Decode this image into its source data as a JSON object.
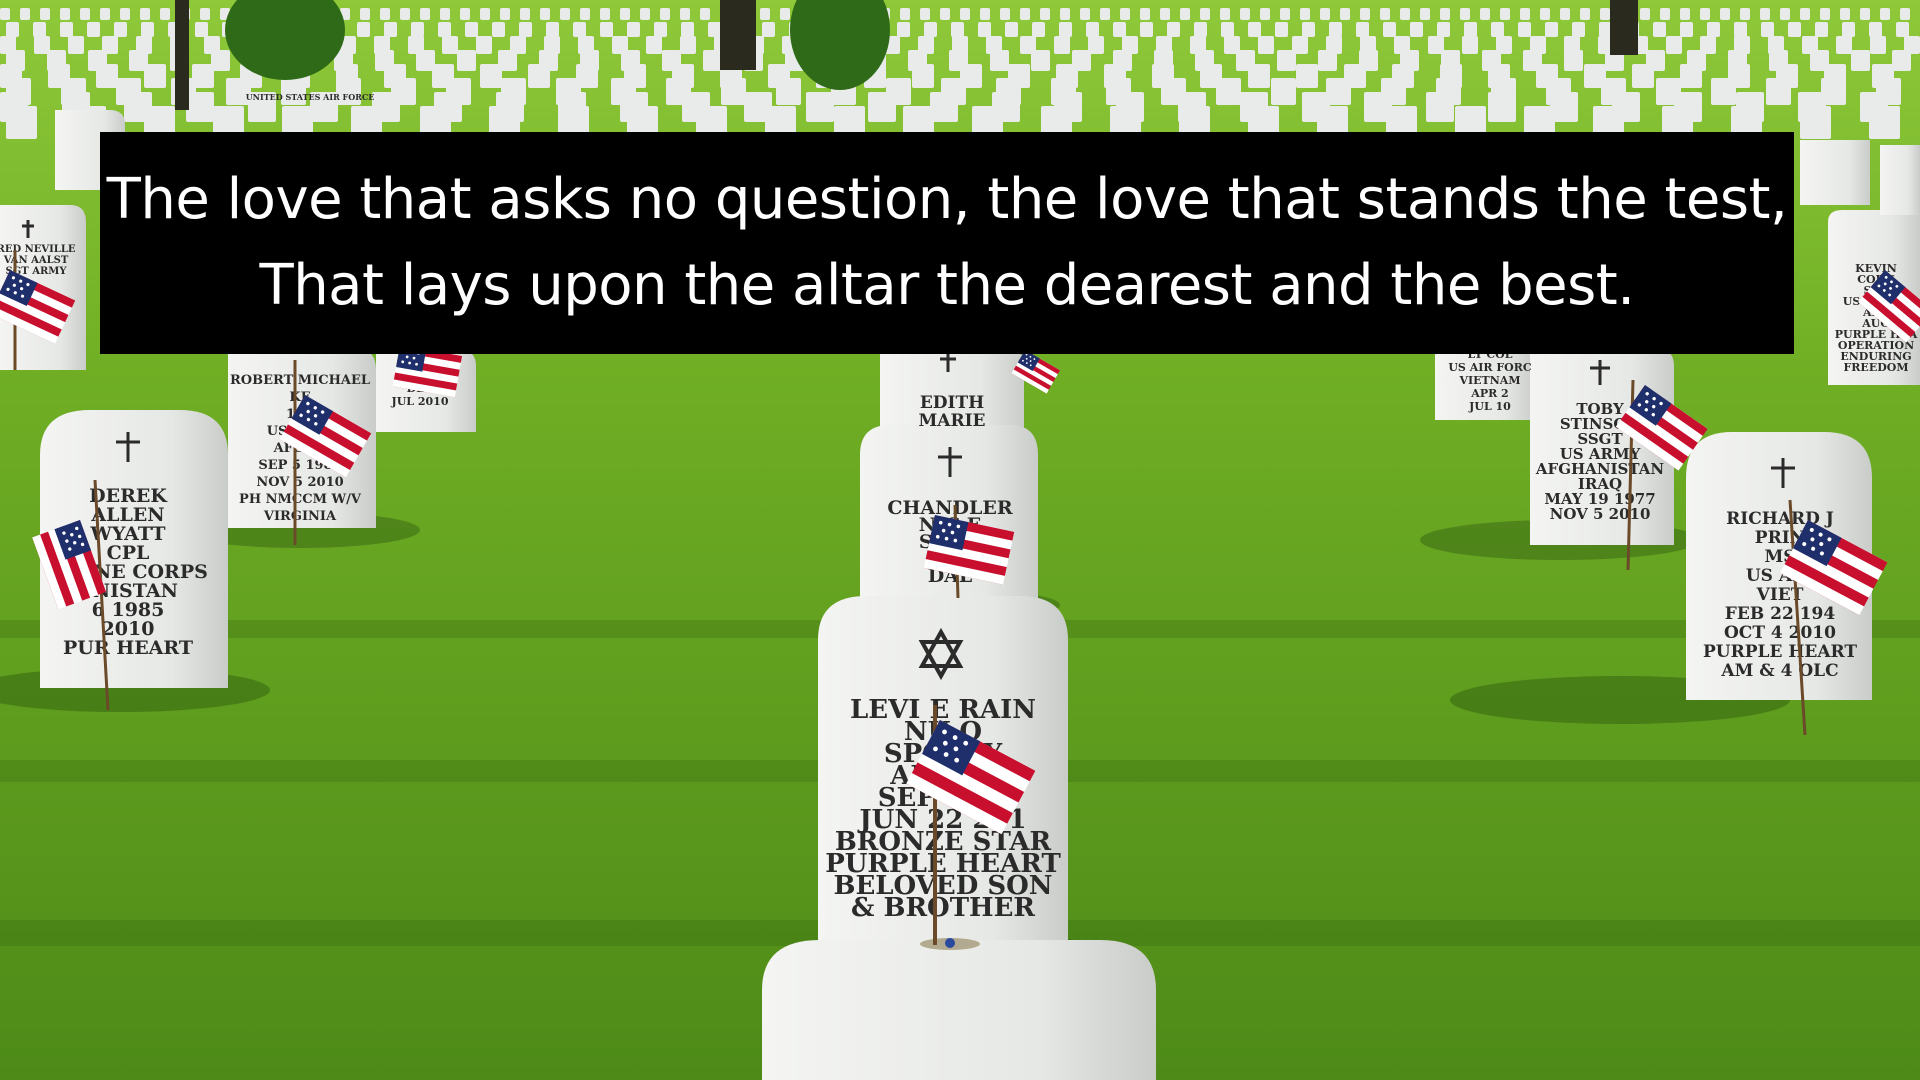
{
  "quote": {
    "line1": "The love that asks no question, the love that stands the test,",
    "line2": "That lays upon the altar the dearest and the best."
  },
  "headstones": {
    "center_front": {
      "symbol": "star-of-david-icon",
      "lines": [
        "LEVI E RAIN",
        "NU  O",
        "SPC U    Y",
        "AFGHA",
        "SEP  1  19",
        "JUN 22 201",
        "BRONZE STAR",
        "PURPLE HEART",
        "BELOVED SON",
        "& BROTHER"
      ]
    },
    "left_front": {
      "symbol": "cross-icon",
      "lines": [
        "DEREK",
        "ALLEN",
        "WYATT",
        "CPL",
        "US  INE CORPS",
        "ANISTAN",
        "6 1985",
        "2010",
        "PUR  HEART"
      ]
    },
    "right_front": {
      "symbol": "cross-icon",
      "lines": [
        "RICHARD J",
        "PRIN",
        "MS",
        "US AIR",
        "VIET",
        "FEB 22 194",
        "OCT 4 2010",
        "PURPLE HEART",
        "AM & 4 OLC"
      ]
    },
    "center_mid": {
      "symbol": "cross-icon",
      "lines": [
        "CHANDLER",
        "NIC  E",
        "SEP   3",
        "NO",
        "DAL"
      ]
    },
    "left_mid": {
      "lines": [
        "ROBERT MICHAEL",
        "KE",
        "1ST",
        "US MARI",
        "AFGHA",
        "SEP 5 1981",
        "NOV 5 2010",
        "PH  NMCCM W/V",
        "VIRGINIA"
      ]
    },
    "right_mid": {
      "symbol": "cross-icon",
      "lines": [
        "TOBY",
        "STINSON",
        "SSGT",
        "US ARMY",
        "AFGHANISTAN",
        "IRAQ",
        "MAY 19 1977",
        "NOV 5 2010"
      ]
    },
    "back_center": {
      "lines": [
        "EDITH",
        "MARIE"
      ]
    },
    "back_right_a": {
      "lines": [
        "LT COL",
        "US AIR FORC",
        "VIETNAM",
        "APR 2",
        "JUL 10"
      ]
    },
    "back_right_b": {
      "lines": [
        "KEVIN",
        "CORN",
        "SCP",
        "US MARIN",
        "APR",
        "AUG",
        "PURPLE HEA",
        "OPERATION",
        "ENDURING",
        "FREEDOM"
      ]
    },
    "back_left_a": {
      "lines": [
        "RED NEVILLE",
        "VAN AALST",
        "SGT ARMY"
      ]
    },
    "back_left_b": {
      "lines": [
        "DEC",
        "JUL 2010"
      ]
    },
    "far_banner": {
      "lines": [
        "UNITED STATES AIR FORCE"
      ]
    }
  },
  "colors": {
    "quote_background": "#000000",
    "quote_text": "#ffffff",
    "grass_light": "#7fbf2a",
    "grass_dark": "#3f7416",
    "marble": "#e9ebe8"
  }
}
